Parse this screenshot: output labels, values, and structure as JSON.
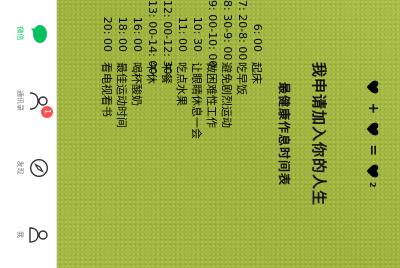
{
  "equation": {
    "plus": "+",
    "equals": "=",
    "exponent": "2"
  },
  "headline": "我申请加入你的人生",
  "subheadline": "最健康作息时间表",
  "schedule": [
    {
      "time": "6: 00",
      "activity": "起床"
    },
    {
      "time": "7: 20-8: 00",
      "activity": "吃早饭"
    },
    {
      "time": "8: 30-9: 00",
      "activity": "避免剧烈运动"
    },
    {
      "time": "9: 00-10: 00",
      "activity": "做困难性工作"
    },
    {
      "time": "10: 30",
      "activity": "让眼睛休息一会"
    },
    {
      "time": "11: 00",
      "activity": "吃点水果"
    },
    {
      "time": "12: 00-12: 30",
      "activity": "午餐"
    },
    {
      "time": "13: 00-14: 00",
      "activity": "午休"
    },
    {
      "time": "16: 00",
      "activity": "喝杯酸奶"
    },
    {
      "time": "18: 00",
      "activity": "最佳运动时间"
    },
    {
      "time": "20: 00",
      "activity": "看电视看书"
    }
  ],
  "navbar": {
    "items": [
      {
        "label": "微信",
        "icon": "chat-bubble-icon",
        "active": true
      },
      {
        "label": "通讯录",
        "icon": "contacts-icon",
        "badge": "1"
      },
      {
        "label": "发现",
        "icon": "compass-icon"
      },
      {
        "label": "我",
        "icon": "person-icon"
      }
    ]
  },
  "colors": {
    "wallpaper": "#a4b83f",
    "accent_green": "#07c160",
    "badge_red": "#fa5151",
    "navbar_bg": "#ffffff"
  }
}
